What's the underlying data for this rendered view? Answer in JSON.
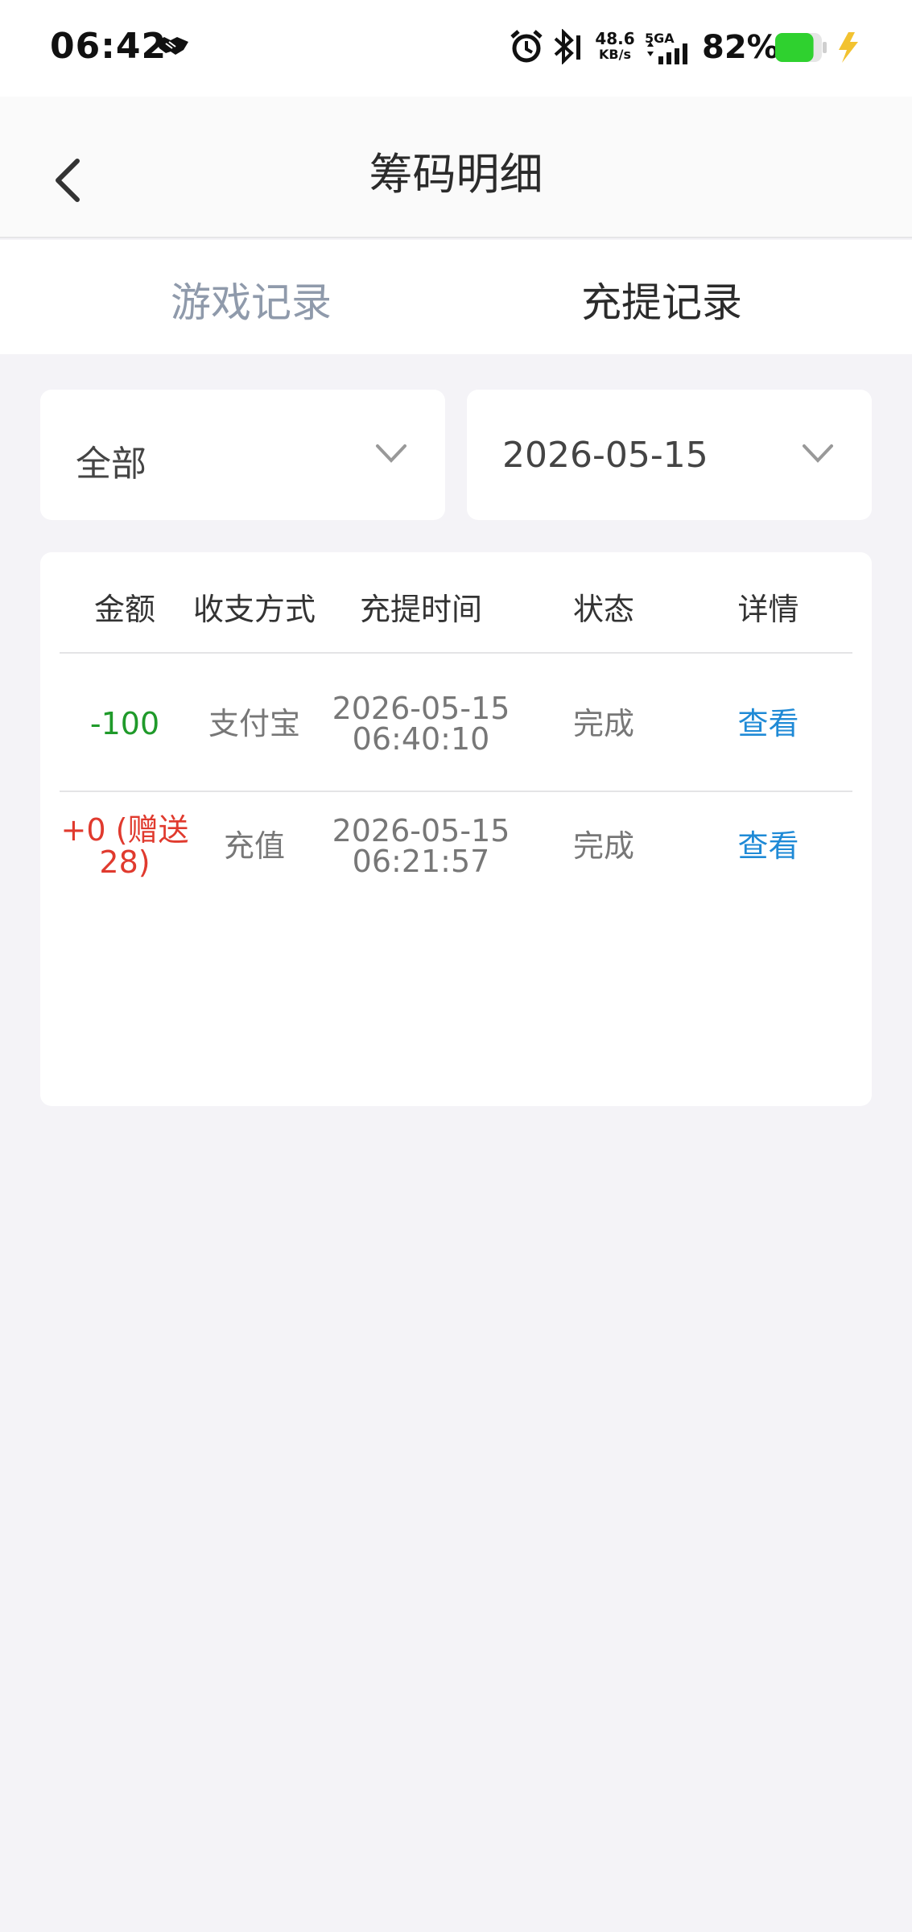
{
  "status_bar": {
    "time": "06:42",
    "net_speed_value": "48.6",
    "net_speed_unit": "KB/s",
    "network_type": "5GA",
    "battery_percent": "82%",
    "battery_level": 0.82,
    "battery_color": "#2fd12f",
    "bolt_color": "#f2c230"
  },
  "header": {
    "title": "筹码明细",
    "back_icon": "chevron-left-icon"
  },
  "tabs": [
    {
      "label": "游戏记录",
      "active": false
    },
    {
      "label": "充提记录",
      "active": true
    }
  ],
  "filters": {
    "type": {
      "value": "全部",
      "icon": "chevron-down-icon"
    },
    "date": {
      "value": "2026-05-15",
      "icon": "chevron-down-icon"
    }
  },
  "table": {
    "columns": [
      "金额",
      "收支方式",
      "充提时间",
      "状态",
      "详情"
    ],
    "rows": [
      {
        "amount": "-100",
        "method": "支付宝",
        "date": "2026-05-15",
        "time": "06:40:10",
        "status": "完成",
        "detail": "查看"
      },
      {
        "amount_line1": "+0 (赠送",
        "amount_line2": "28)",
        "method": "充值",
        "date": "2026-05-15",
        "time": "06:21:57",
        "status": "完成",
        "detail": "查看"
      }
    ]
  },
  "colors": {
    "negative_amount": "#1f9a2a",
    "positive_amount": "#e03a2e",
    "link": "#1f8ad6",
    "inactive_tab": "#8f9aab",
    "background": "#f4f3f7"
  }
}
